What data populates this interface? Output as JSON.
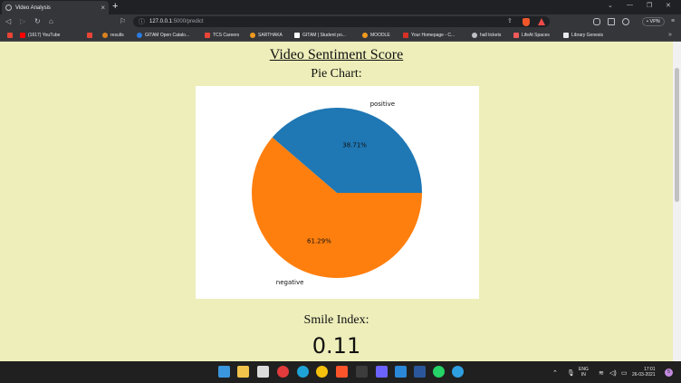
{
  "browser": {
    "tab_title": "Video Analysis",
    "tab_close": "×",
    "new_tab": "+",
    "url_host": "127.0.0.1",
    "url_path": ":5000/predict",
    "vpn_label": "• VPN",
    "bookmarks": [
      {
        "label": "",
        "color": "#e94435"
      },
      {
        "label": "(1617) YouTube",
        "color": "#ff0000"
      },
      {
        "label": "results",
        "color": "#e94435"
      },
      {
        "label": "GITAM Open Catalo...",
        "color": "#d9821e"
      },
      {
        "label": "TCS Careers",
        "color": "#2a7de1"
      },
      {
        "label": "SARTHAKA",
        "color": "#ffffff"
      },
      {
        "label": "GITAM | Student po...",
        "color": "#f09a1e"
      },
      {
        "label": "MOODLE",
        "color": "#8ab4f8"
      },
      {
        "label": "Your Homepage - C...",
        "color": "#f09a1e"
      },
      {
        "label": "hall tickets",
        "color": "#d93025"
      },
      {
        "label": "LifeAt Spaces",
        "color": "#bdc1c6"
      },
      {
        "label": "Library Genesis",
        "color": "#f15a5a"
      }
    ]
  },
  "page": {
    "title": "Video Sentiment Score",
    "chart_heading": "Pie Chart:",
    "smile_heading": "Smile Index:",
    "smile_value": "0.11"
  },
  "chart_data": {
    "type": "pie",
    "labels": [
      "positive",
      "negative"
    ],
    "values": [
      38.71,
      61.29
    ],
    "percent_labels": [
      "38.71%",
      "61.29%"
    ],
    "colors": [
      "#1f77b4",
      "#ff7f0e"
    ],
    "start_angle_deg": 0,
    "legend": "none"
  },
  "taskbar": {
    "lang_top": "ENG",
    "lang_bottom": "IN",
    "time": "17:01",
    "date": "26-03-2021",
    "notif_count": "5"
  }
}
